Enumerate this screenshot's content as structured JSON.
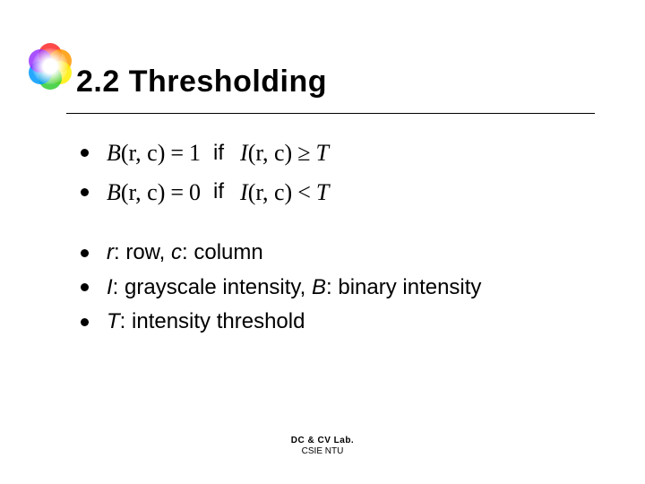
{
  "title": "2.2 Thresholding",
  "equations": [
    {
      "lhs_fn": "B",
      "lhs_args": "(r, c)",
      "lhs_eq": "=",
      "lhs_val": "1",
      "if": "if",
      "rhs_fn": "I",
      "rhs_args": "(r, c)",
      "rel": "≥",
      "T": "T"
    },
    {
      "lhs_fn": "B",
      "lhs_args": "(r, c)",
      "lhs_eq": "=",
      "lhs_val": "0",
      "if": "if",
      "rhs_fn": "I",
      "rhs_args": "(r, c)",
      "rel": "<",
      "T": "T"
    }
  ],
  "defs": [
    {
      "v1": "r",
      "d1": ": row, ",
      "v2": "c",
      "d2": ": column"
    },
    {
      "v1": "I",
      "d1": ": grayscale intensity, ",
      "v2": "B",
      "d2": ": binary intensity"
    },
    {
      "v1": "T",
      "d1": ": intensity threshold",
      "v2": "",
      "d2": ""
    }
  ],
  "footer": {
    "line1": "DC & CV Lab.",
    "line2": "CSIE NTU"
  }
}
